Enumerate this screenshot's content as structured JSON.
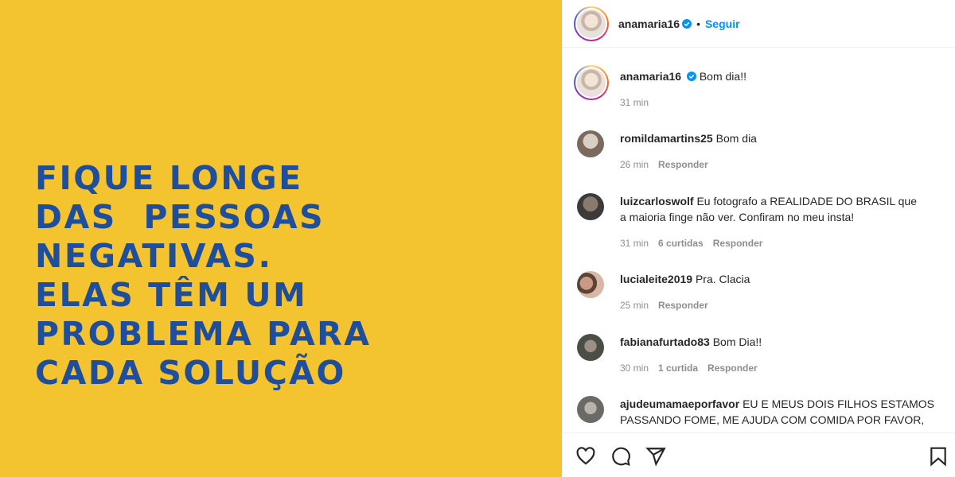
{
  "post": {
    "text_lines": [
      "FIQUE LONGE",
      "DAS  PESSOAS",
      "NEGATIVAS.",
      "ELAS TÊM UM",
      "PROBLEMA PARA",
      "CADA SOLUÇÃO"
    ],
    "background": "#f4c430",
    "text_color": "#1f4e9c"
  },
  "header": {
    "username": "anamaria16",
    "separator": "•",
    "follow_label": "Seguir"
  },
  "caption": {
    "username": "anamaria16",
    "text": "Bom dia!!",
    "time": "31 min"
  },
  "comments": [
    {
      "username": "romildamartins25",
      "line1": "Bom dia",
      "line2": "",
      "time": "26 min",
      "likes": "",
      "reply": "Responder"
    },
    {
      "username": "luizcarloswolf",
      "line1": "Eu fotografo a REALIDADE DO BRASIL que",
      "line2": "a maioria finge não ver. Confiram no meu insta!",
      "time": "31 min",
      "likes": "6 curtidas",
      "reply": "Responder"
    },
    {
      "username": "lucialeite2019",
      "line1": "Pra. Clacia",
      "line2": "",
      "time": "25 min",
      "likes": "",
      "reply": "Responder"
    },
    {
      "username": "fabianafurtado83",
      "line1": "Bom Dia!!",
      "line2": "",
      "time": "30 min",
      "likes": "1 curtida",
      "reply": "Responder"
    },
    {
      "username": "ajudeumamaeporfavor",
      "line1": "EU E MEUS DOIS FILHOS ESTAMOS",
      "line2": "PASSANDO FOME, ME AJUDA COM COMIDA POR FAVOR,",
      "time": "",
      "likes": "",
      "reply": ""
    }
  ],
  "icons": {
    "like": "heart-icon",
    "comment": "comment-icon",
    "share": "share-icon",
    "save": "bookmark-icon",
    "verified": "verified-badge-icon"
  },
  "colors": {
    "accent": "#0095f6",
    "muted": "#8e8e8e"
  }
}
